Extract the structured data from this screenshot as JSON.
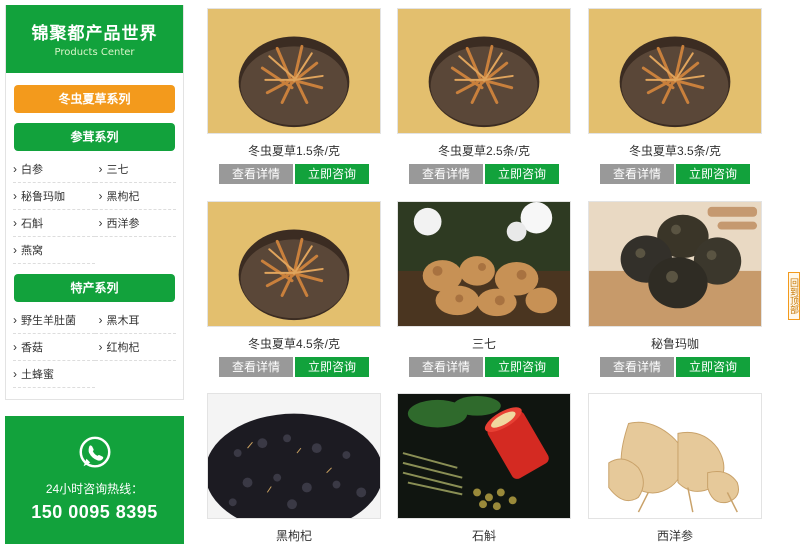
{
  "sidebar": {
    "title": "锦聚都产品世界",
    "subtitle": "Products Center",
    "categories": [
      {
        "label": "冬虫夏草系列",
        "items": []
      },
      {
        "label": "参茸系列",
        "items": [
          "白参",
          "三七",
          "秘鲁玛咖",
          "黑枸杞",
          "石斛",
          "西洋参",
          "燕窝"
        ]
      },
      {
        "label": "特产系列",
        "items": [
          "野生羊肚菌",
          "黑木耳",
          "香菇",
          "红枸杞",
          "土蜂蜜"
        ]
      }
    ],
    "contact": {
      "icon": "whatsapp-icon",
      "label": "24小时咨询热线：",
      "phone": "150 0095 8395"
    }
  },
  "products": [
    {
      "name": "冬虫夏草1.5条/克",
      "detail": "查看详情",
      "consult": "立即咨询"
    },
    {
      "name": "冬虫夏草2.5条/克",
      "detail": "查看详情",
      "consult": "立即咨询"
    },
    {
      "name": "冬虫夏草3.5条/克",
      "detail": "查看详情",
      "consult": "立即咨询"
    },
    {
      "name": "冬虫夏草4.5条/克",
      "detail": "查看详情",
      "consult": "立即咨询"
    },
    {
      "name": "三七",
      "detail": "查看详情",
      "consult": "立即咨询"
    },
    {
      "name": "秘鲁玛咖",
      "detail": "查看详情",
      "consult": "立即咨询"
    },
    {
      "name": "黑枸杞"
    },
    {
      "name": "石斛"
    },
    {
      "name": "西洋参"
    }
  ],
  "side_tab": "回到顶部",
  "colors": {
    "green": "#12a23c",
    "orange": "#f39a1c",
    "gray": "#999999"
  }
}
